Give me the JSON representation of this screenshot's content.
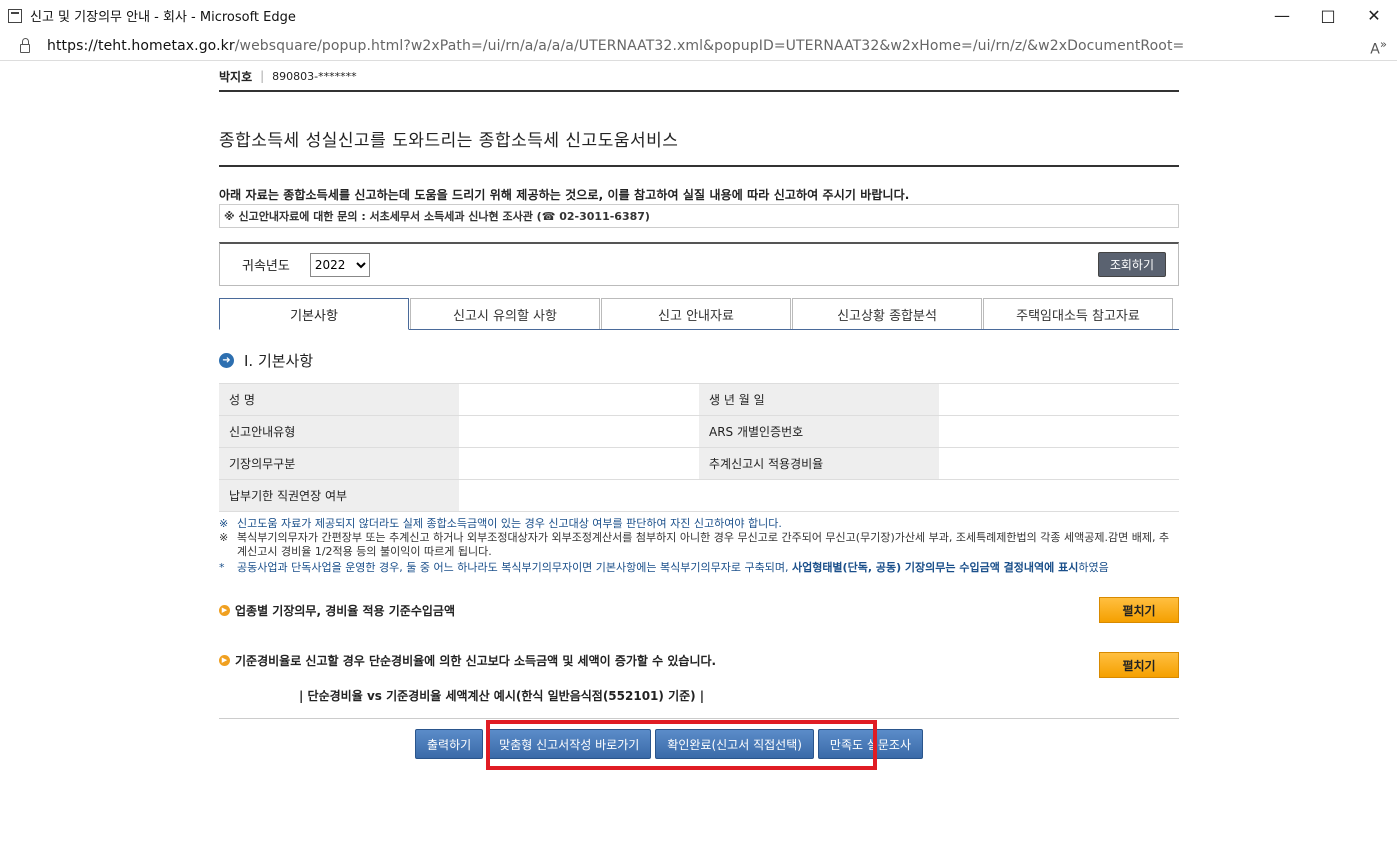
{
  "window": {
    "title": "신고 및 기장의무 안내 - 회사 - Microsoft Edge",
    "url_host": "https://teht.hometax.go.kr",
    "url_path": "/websquare/popup.html?w2xPath=/ui/rn/a/a/a/a/UTERNAAT32.xml&popupID=UTERNAAT32&w2xHome=/ui/rn/z/&w2xDocumentRoot="
  },
  "user": {
    "name": "박지호",
    "ssn": "890803-*******"
  },
  "headline": "종합소득세 성실신고를 도와드리는 종합소득세 신고도움서비스",
  "notice": "아래 자료는 종합소득세를 신고하는데 도움을 드리기 위해 제공하는 것으로, 이를 참고하여 실질 내용에 따라 신고하여 주시기 바랍니다.",
  "contact": "※ 신고안내자료에 대한 문의 : 서초세무서 소득세과 신나현 조사관 (☎ 02-3011-6387)",
  "search": {
    "label": "귀속년도",
    "year": "2022",
    "button": "조회하기"
  },
  "tabs": [
    "기본사항",
    "신고시 유의할 사항",
    "신고 안내자료",
    "신고상황 종합분석",
    "주택임대소득 참고자료"
  ],
  "section_title": "Ⅰ. 기본사항",
  "info_rows": [
    {
      "left_label": "성            명",
      "right_label": "생  년  월  일"
    },
    {
      "left_label": "신고안내유형",
      "right_label": "ARS 개별인증번호"
    },
    {
      "left_label": "기장의무구분",
      "right_label": "추계신고시 적용경비율"
    },
    {
      "left_label": "납부기한 직권연장 여부",
      "right_label": ""
    }
  ],
  "notes": {
    "n1_mark": "※",
    "n1": "신고도움 자료가 제공되지 않더라도 실제 종합소득금액이 있는 경우 신고대상 여부를 판단하여 자진 신고하여야 합니다.",
    "n2_mark": "※",
    "n2": "복식부기의무자가 간편장부 또는 추계신고 하거나 외부조정대상자가 외부조정계산서를 첨부하지 아니한 경우 무신고로 간주되어 무신고(무기장)가산세 부과, 조세특례제한법의 각종 세액공제.감면 배제, 추계신고시 경비율 1/2적용 등의 불이익이 따르게 됩니다.",
    "n3_mark": "*",
    "n3_a": "공동사업과 단독사업을 운영한 경우, 둘 중 어느 하나라도 복식부기의무자이면 기본사항에는 복식부기의무자로 구축되며, ",
    "n3_b": "사업형태별(단독, 공동) 기장의무는 수입금액 결정내역에 표시",
    "n3_c": "하였음"
  },
  "subsec1": {
    "title": "업종별 기장의무, 경비율 적용 기준수입금액",
    "button": "펼치기"
  },
  "subsec2": {
    "title": "기준경비율로 신고할 경우 단순경비율에 의한 신고보다 소득금액 및 세액이 증가할 수 있습니다.",
    "button": "펼치기"
  },
  "compare_title": "| 단순경비율 vs 기준경비율 세액계산 예시(한식 일반음식점(552101) 기준) |",
  "actions": {
    "print": "출력하기",
    "custom": "맞춤형 신고서작성 바로가기",
    "confirm": "확인완료(신고서 직접선택)",
    "survey": "만족도 설문조사"
  }
}
